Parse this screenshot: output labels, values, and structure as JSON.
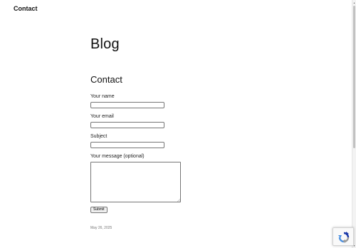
{
  "header": {
    "site_title": "Contact"
  },
  "main": {
    "blog_heading": "Blog",
    "post_title": "Contact",
    "form": {
      "name_label": "Your name",
      "name_value": "",
      "email_label": "Your email",
      "email_value": "",
      "subject_label": "Subject",
      "subject_value": "",
      "message_label": "Your message (optional)",
      "message_value": "",
      "submit_label": "Submit"
    },
    "post_date": "May 26, 2025"
  },
  "widgets": {
    "recaptcha_icon": "recaptcha-logo-icon",
    "recaptcha_colors": {
      "blue": "#4a90e2",
      "dark": "#1c3aa9",
      "gray": "#9b9b9b"
    }
  },
  "scrollbar": {
    "up_icon": "chevron-up-icon",
    "down_icon": "chevron-down-icon"
  }
}
